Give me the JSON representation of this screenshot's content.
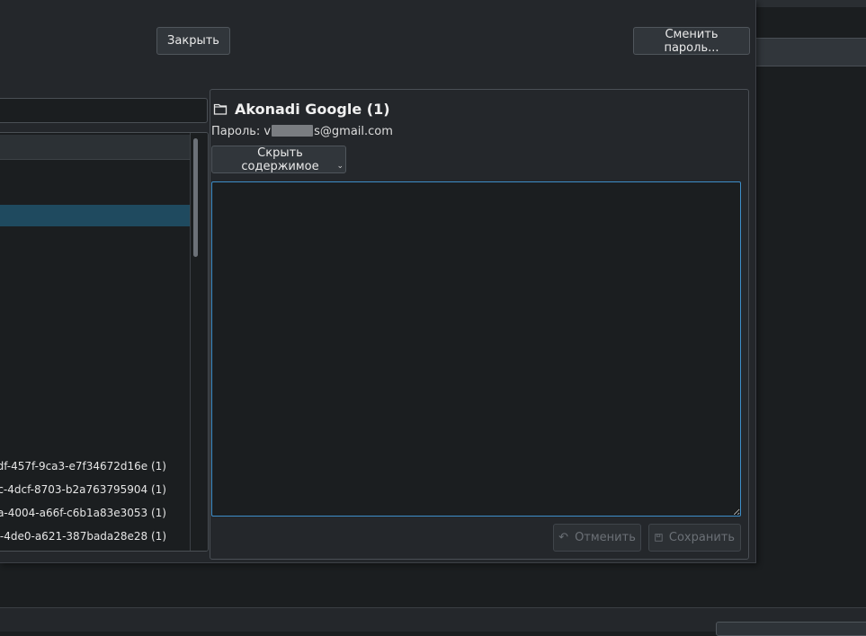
{
  "window": {
    "close_label": "Закрыть",
    "change_password_label": "Сменить пароль..."
  },
  "tree": {
    "items": [
      {
        "label": "df-457f-9ca3-e7f34672d16e (1)"
      },
      {
        "label": "c-4dcf-8703-b2a763795904 (1)"
      },
      {
        "label": "4a-4004-a66f-c6b1a83e3053 (1)"
      },
      {
        "label": "7-4de0-a621-387bada28e28 (1)"
      }
    ]
  },
  "detail": {
    "icon": "folder-icon",
    "title": "Akonadi Google (1)",
    "password_prefix": "Пароль: v",
    "password_suffix": "s@gmail.com",
    "hide_label": "Скрыть содержимое",
    "cancel_label": "Отменить",
    "save_label": "Сохранить",
    "editor_value": ""
  },
  "colors": {
    "accent": "#3d8ec9",
    "selection": "#1f4a5f",
    "background": "#1b1e20",
    "panel": "#24272b"
  }
}
